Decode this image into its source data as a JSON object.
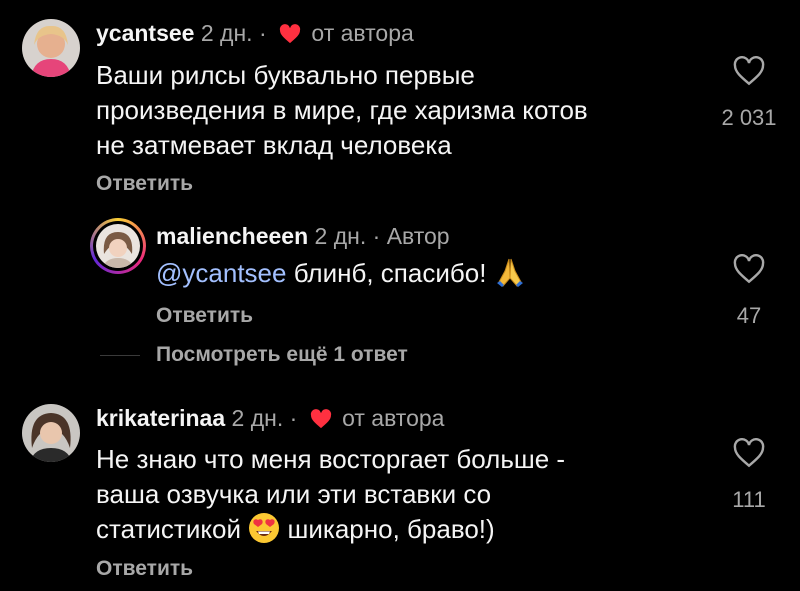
{
  "comments": [
    {
      "username": "ycantsee",
      "age": "2 дн.",
      "dot": "·",
      "author_liked": "от автора",
      "text_lines": [
        "Ваши рилсы буквально первые",
        "произведения в мире, где харизма котов",
        "не затмевает вклад человека"
      ],
      "reply_label": "Ответить",
      "likes": "2 031"
    },
    {
      "username": "maliencheeen",
      "age": "2 дн.",
      "dot": "·",
      "author_tag": "Автор",
      "mention": "@ycantsee",
      "text": " блинб, спасибо!",
      "emoji": "folded-hands-icon",
      "reply_label": "Ответить",
      "likes": "47"
    },
    {
      "username": "krikaterinaa",
      "age": "2 дн.",
      "dot": "·",
      "author_liked": "от автора",
      "text_lines": [
        "Не знаю что меня восторгает больше -",
        "ваша озвучка или эти вставки со",
        "статистикой",
        " шикарно, браво!)"
      ],
      "emoji": "heart-eyes-icon",
      "reply_label": "Ответить",
      "likes": "111"
    }
  ],
  "view_more_replies": "Посмотреть ещё 1 ответ",
  "colors": {
    "background": "#000000",
    "text": "#f5f5f5",
    "secondary": "#a8a8a8",
    "like_red": "#ff3040",
    "mention": "#a3c0ff"
  }
}
